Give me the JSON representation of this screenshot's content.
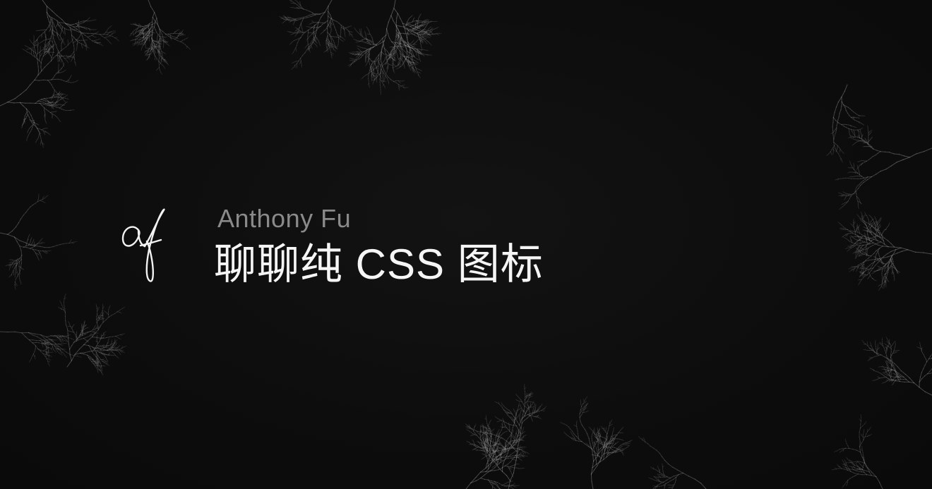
{
  "author": "Anthony Fu",
  "title": "聊聊纯 CSS 图标",
  "logo_icon": "af-signature-icon",
  "background_icon": "plum-branches-icon",
  "colors": {
    "background": "#0c0c0c",
    "title": "#f5f5f5",
    "author": "#8a8a8a",
    "branches": "#bdbdbd"
  }
}
